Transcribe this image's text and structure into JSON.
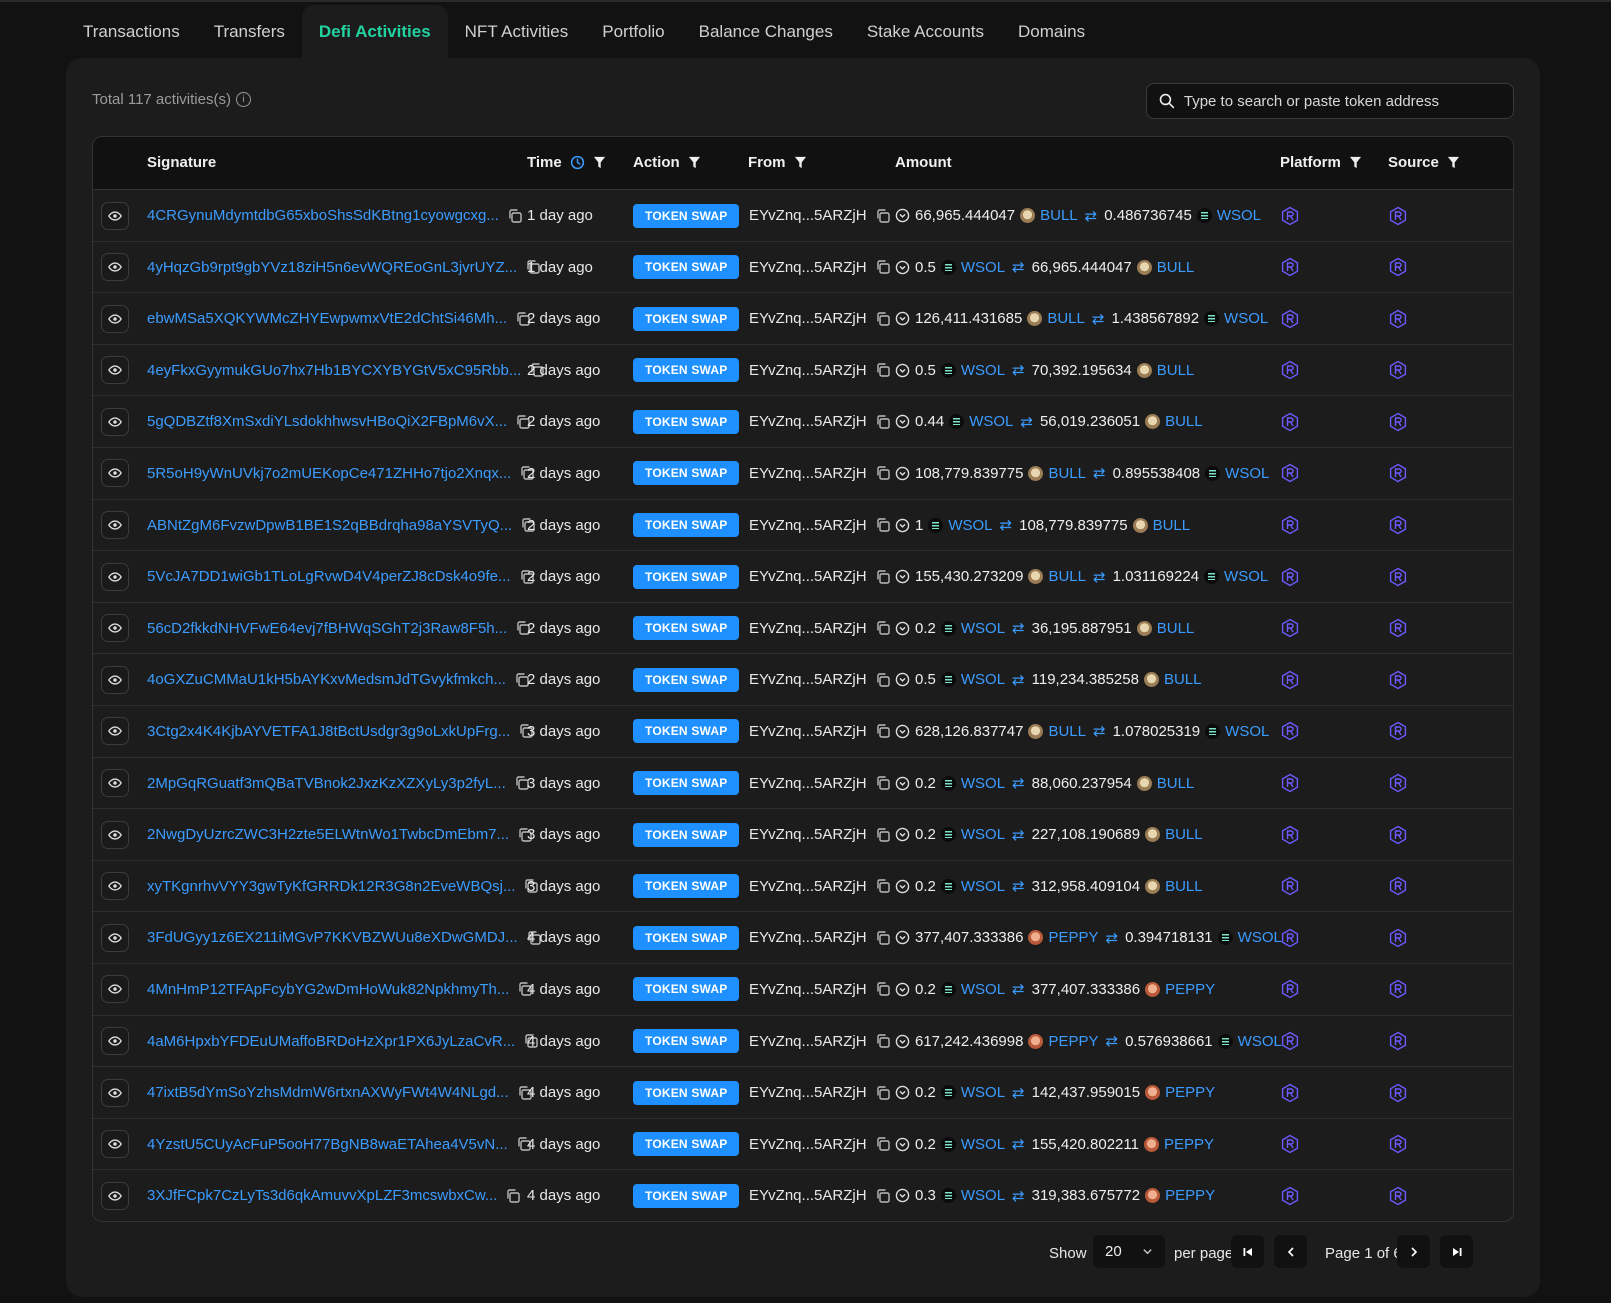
{
  "tabs": [
    {
      "label": "Transactions",
      "active": false
    },
    {
      "label": "Transfers",
      "active": false
    },
    {
      "label": "Defi Activities",
      "active": true
    },
    {
      "label": "NFT Activities",
      "active": false
    },
    {
      "label": "Portfolio",
      "active": false
    },
    {
      "label": "Balance Changes",
      "active": false
    },
    {
      "label": "Stake Accounts",
      "active": false
    },
    {
      "label": "Domains",
      "active": false
    }
  ],
  "total_text": "Total 117 activities(s)",
  "search": {
    "placeholder": "Type to search or paste token address"
  },
  "columns": {
    "signature": "Signature",
    "time": "Time",
    "action": "Action",
    "from": "From",
    "amount": "Amount",
    "platform": "Platform",
    "source": "Source"
  },
  "rows": [
    {
      "signature": "4CRGynuMdymtdbG65xboShsSdKBtng1cyowgcxg...",
      "time": "1 day ago",
      "action": "TOKEN SWAP",
      "from": "EYvZnq...5ARZjH",
      "amount_in": "66,965.444047",
      "token_in": "BULL",
      "amount_out": "0.486736745",
      "token_out": "WSOL"
    },
    {
      "signature": "4yHqzGb9rpt9gbYVz18ziH5n6evWQREoGnL3jvrUYZ...",
      "time": "1 day ago",
      "action": "TOKEN SWAP",
      "from": "EYvZnq...5ARZjH",
      "amount_in": "0.5",
      "token_in": "WSOL",
      "amount_out": "66,965.444047",
      "token_out": "BULL"
    },
    {
      "signature": "ebwMSa5XQKYWMcZHYEwpwmxVtE2dChtSi46Mh...",
      "time": "2 days ago",
      "action": "TOKEN SWAP",
      "from": "EYvZnq...5ARZjH",
      "amount_in": "126,411.431685",
      "token_in": "BULL",
      "amount_out": "1.438567892",
      "token_out": "WSOL"
    },
    {
      "signature": "4eyFkxGyymukGUo7hx7Hb1BYCXYBYGtV5xC95Rbb...",
      "time": "2 days ago",
      "action": "TOKEN SWAP",
      "from": "EYvZnq...5ARZjH",
      "amount_in": "0.5",
      "token_in": "WSOL",
      "amount_out": "70,392.195634",
      "token_out": "BULL"
    },
    {
      "signature": "5gQDBZtf8XmSxdiYLsdokhhwsvHBoQiX2FBpM6vX...",
      "time": "2 days ago",
      "action": "TOKEN SWAP",
      "from": "EYvZnq...5ARZjH",
      "amount_in": "0.44",
      "token_in": "WSOL",
      "amount_out": "56,019.236051",
      "token_out": "BULL"
    },
    {
      "signature": "5R5oH9yWnUVkj7o2mUEKopCe471ZHHo7tjo2Xnqx...",
      "time": "2 days ago",
      "action": "TOKEN SWAP",
      "from": "EYvZnq...5ARZjH",
      "amount_in": "108,779.839775",
      "token_in": "BULL",
      "amount_out": "0.895538408",
      "token_out": "WSOL"
    },
    {
      "signature": "ABNtZgM6FvzwDpwB1BE1S2qBBdrqha98aYSVTyQ...",
      "time": "2 days ago",
      "action": "TOKEN SWAP",
      "from": "EYvZnq...5ARZjH",
      "amount_in": "1",
      "token_in": "WSOL",
      "amount_out": "108,779.839775",
      "token_out": "BULL"
    },
    {
      "signature": "5VcJA7DD1wiGb1TLoLgRvwD4V4perZJ8cDsk4o9fe...",
      "time": "2 days ago",
      "action": "TOKEN SWAP",
      "from": "EYvZnq...5ARZjH",
      "amount_in": "155,430.273209",
      "token_in": "BULL",
      "amount_out": "1.031169224",
      "token_out": "WSOL"
    },
    {
      "signature": "56cD2fkkdNHVFwE64evj7fBHWqSGhT2j3Raw8F5h...",
      "time": "2 days ago",
      "action": "TOKEN SWAP",
      "from": "EYvZnq...5ARZjH",
      "amount_in": "0.2",
      "token_in": "WSOL",
      "amount_out": "36,195.887951",
      "token_out": "BULL"
    },
    {
      "signature": "4oGXZuCMMaU1kH5bAYKxvMedsmJdTGvykfmkch...",
      "time": "2 days ago",
      "action": "TOKEN SWAP",
      "from": "EYvZnq...5ARZjH",
      "amount_in": "0.5",
      "token_in": "WSOL",
      "amount_out": "119,234.385258",
      "token_out": "BULL"
    },
    {
      "signature": "3Ctg2x4K4KjbAYVETFA1J8tBctUsdgr3g9oLxkUpFrg...",
      "time": "3 days ago",
      "action": "TOKEN SWAP",
      "from": "EYvZnq...5ARZjH",
      "amount_in": "628,126.837747",
      "token_in": "BULL",
      "amount_out": "1.078025319",
      "token_out": "WSOL"
    },
    {
      "signature": "2MpGqRGuatf3mQBaTVBnok2JxzKzXZXyLy3p2fyL...",
      "time": "3 days ago",
      "action": "TOKEN SWAP",
      "from": "EYvZnq...5ARZjH",
      "amount_in": "0.2",
      "token_in": "WSOL",
      "amount_out": "88,060.237954",
      "token_out": "BULL"
    },
    {
      "signature": "2NwgDyUzrcZWC3H2zte5ELWtnWo1TwbcDmEbm7...",
      "time": "3 days ago",
      "action": "TOKEN SWAP",
      "from": "EYvZnq...5ARZjH",
      "amount_in": "0.2",
      "token_in": "WSOL",
      "amount_out": "227,108.190689",
      "token_out": "BULL"
    },
    {
      "signature": "xyTKgnrhvVYY3gwTyKfGRRDk12R3G8n2EveWBQsj...",
      "time": "3 days ago",
      "action": "TOKEN SWAP",
      "from": "EYvZnq...5ARZjH",
      "amount_in": "0.2",
      "token_in": "WSOL",
      "amount_out": "312,958.409104",
      "token_out": "BULL"
    },
    {
      "signature": "3FdUGyy1z6EX211iMGvP7KKVBZWUu8eXDwGMDJ...",
      "time": "4 days ago",
      "action": "TOKEN SWAP",
      "from": "EYvZnq...5ARZjH",
      "amount_in": "377,407.333386",
      "token_in": "PEPPY",
      "amount_out": "0.394718131",
      "token_out": "WSOL"
    },
    {
      "signature": "4MnHmP12TFApFcybYG2wDmHoWuk82NpkhmyTh...",
      "time": "4 days ago",
      "action": "TOKEN SWAP",
      "from": "EYvZnq...5ARZjH",
      "amount_in": "0.2",
      "token_in": "WSOL",
      "amount_out": "377,407.333386",
      "token_out": "PEPPY"
    },
    {
      "signature": "4aM6HpxbYFDEuUMaffoBRDoHzXpr1PX6JyLzaCvR...",
      "time": "4 days ago",
      "action": "TOKEN SWAP",
      "from": "EYvZnq...5ARZjH",
      "amount_in": "617,242.436998",
      "token_in": "PEPPY",
      "amount_out": "0.576938661",
      "token_out": "WSOL"
    },
    {
      "signature": "47ixtB5dYmSoYzhsMdmW6rtxnAXWyFWt4W4NLgd...",
      "time": "4 days ago",
      "action": "TOKEN SWAP",
      "from": "EYvZnq...5ARZjH",
      "amount_in": "0.2",
      "token_in": "WSOL",
      "amount_out": "142,437.959015",
      "token_out": "PEPPY"
    },
    {
      "signature": "4YzstU5CUyAcFuP5ooH77BgNB8waETAhea4V5vN...",
      "time": "4 days ago",
      "action": "TOKEN SWAP",
      "from": "EYvZnq...5ARZjH",
      "amount_in": "0.2",
      "token_in": "WSOL",
      "amount_out": "155,420.802211",
      "token_out": "PEPPY"
    },
    {
      "signature": "3XJfFCpk7CzLyTs3d6qkAmuvvXpLZF3mcswbxCw...",
      "time": "4 days ago",
      "action": "TOKEN SWAP",
      "from": "EYvZnq...5ARZjH",
      "amount_in": "0.3",
      "token_in": "WSOL",
      "amount_out": "319,383.675772",
      "token_out": "PEPPY"
    }
  ],
  "pagination": {
    "show_label": "Show",
    "per_page_value": "20",
    "per_page_label": "per page",
    "page_info": "Page 1 of 6"
  },
  "colors": {
    "accent": "#22d3a0",
    "link": "#3b9cff",
    "badge": "#1e90ff",
    "platform": "#6b5cff"
  }
}
